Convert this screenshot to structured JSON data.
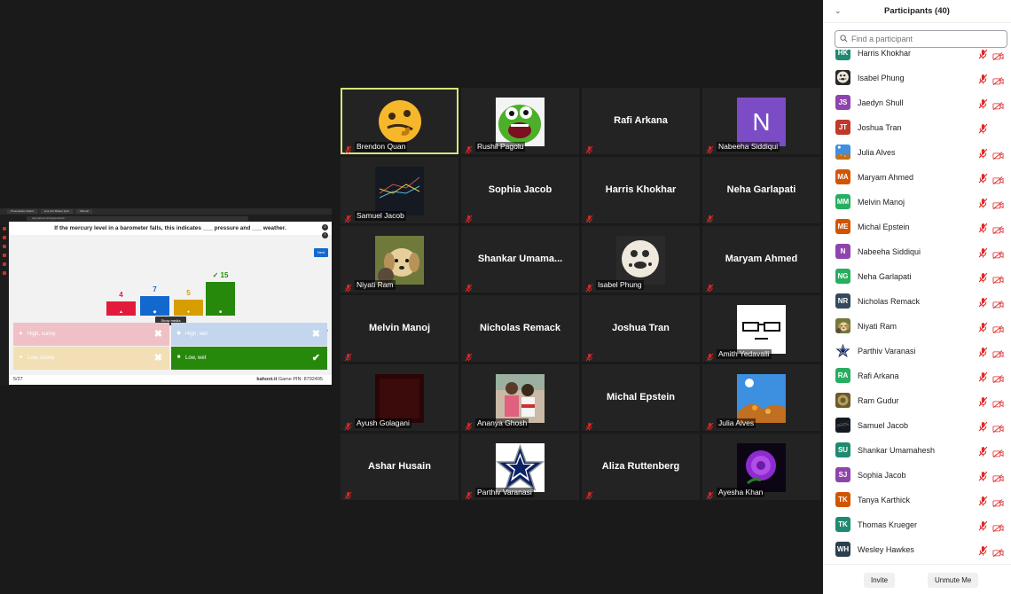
{
  "share": {
    "tabs": [
      "Presentation-Island",
      "Live Hot Master Quiz",
      "Kahoot!"
    ],
    "url": "play.kahoot.it/v2/gameblock",
    "question": "If the mercury level in a barometer falls, this indicates ___ pressure and ___ weather.",
    "next_label": "Next",
    "show_media_label": "Show media",
    "end_game_label": "End game",
    "results": [
      {
        "count": "4",
        "value": 4,
        "color": "#e21b3c",
        "shape": "▲"
      },
      {
        "count": "7",
        "value": 7,
        "color": "#1368ce",
        "shape": "◆"
      },
      {
        "count": "5",
        "value": 5,
        "color": "#d89e00",
        "shape": "●"
      },
      {
        "count": "✓ 15",
        "value": 15,
        "color": "#26890c",
        "shape": "■"
      }
    ],
    "answers": [
      {
        "text": "High, sunny",
        "shape": "▲",
        "mark": "✖",
        "color": "#f0c0c7"
      },
      {
        "text": "High, wet",
        "shape": "◆",
        "mark": "✖",
        "color": "#c3d6ee"
      },
      {
        "text": "Low, sunny",
        "shape": "●",
        "mark": "✖",
        "color": "#f2dfb5"
      },
      {
        "text": "Low, wet",
        "shape": "■",
        "mark": "✔",
        "color": "#26890c"
      }
    ],
    "progress": "5/27",
    "footer_site": "kahoot.it",
    "footer_pin": "Game PIN: 8792495"
  },
  "gallery": [
    {
      "name": "Brendon Quan",
      "type": "emoji",
      "active": true
    },
    {
      "name": "Rushil Pagolu",
      "type": "monster"
    },
    {
      "name": "Rafi Arkana",
      "type": "text",
      "label": ""
    },
    {
      "name": "Nabeeha Siddiqui",
      "type": "letter",
      "letter": "N"
    },
    {
      "name": "Samuel Jacob",
      "type": "dark"
    },
    {
      "name": "Sophia Jacob",
      "type": "text",
      "label": ""
    },
    {
      "name": "Harris Khokhar",
      "type": "text",
      "label": ""
    },
    {
      "name": "Neha Garlapati",
      "type": "text",
      "label": ""
    },
    {
      "name": "Niyati Ram",
      "type": "dog"
    },
    {
      "name": "Shankar  Umama...",
      "type": "text",
      "label": ""
    },
    {
      "name": "Isabel Phung",
      "type": "cookie"
    },
    {
      "name": "Maryam Ahmed",
      "type": "text",
      "label": ""
    },
    {
      "name": "Melvin Manoj",
      "type": "text",
      "label": ""
    },
    {
      "name": "Nicholas Remack",
      "type": "text",
      "label": ""
    },
    {
      "name": "Joshua Tran",
      "type": "text",
      "label": ""
    },
    {
      "name": "Amith Yedavalli",
      "type": "glasses"
    },
    {
      "name": "Ayush Golagani",
      "type": "darkred"
    },
    {
      "name": "Ananya Ghosh",
      "type": "photo"
    },
    {
      "name": "Michal Epstein",
      "type": "text",
      "label": ""
    },
    {
      "name": "Julia Alves",
      "type": "sky"
    },
    {
      "name": "Ashar Husain",
      "type": "text",
      "label": ""
    },
    {
      "name": "Parthiv Varanasi",
      "type": "star"
    },
    {
      "name": "Aliza Ruttenberg",
      "type": "text",
      "label": ""
    },
    {
      "name": "Ayesha Khan",
      "type": "rose"
    }
  ],
  "panel": {
    "title": "Participants (40)",
    "search_placeholder": "Find a participant",
    "invite_label": "Invite",
    "unmute_label": "Unmute Me",
    "participants": [
      {
        "initials": "HK",
        "name": "Harris Khokhar",
        "color": "#1f8a70",
        "video": true
      },
      {
        "initials": "",
        "name": "Isabel Phung",
        "color": "#555",
        "img": "cookie",
        "video": true
      },
      {
        "initials": "JS",
        "name": "Jaedyn Shull",
        "color": "#8e44ad",
        "video": true
      },
      {
        "initials": "JT",
        "name": "Joshua Tran",
        "color": "#c0392b",
        "video": false
      },
      {
        "initials": "",
        "name": "Julia Alves",
        "color": "#3b7fc4",
        "img": "sky",
        "video": true
      },
      {
        "initials": "MA",
        "name": "Maryam Ahmed",
        "color": "#d35400",
        "video": true
      },
      {
        "initials": "MM",
        "name": "Melvin Manoj",
        "color": "#27ae60",
        "video": true
      },
      {
        "initials": "ME",
        "name": "Michal Epstein",
        "color": "#d35400",
        "video": true
      },
      {
        "initials": "N",
        "name": "Nabeeha Siddiqui",
        "color": "#8e44ad",
        "video": true
      },
      {
        "initials": "NG",
        "name": "Neha Garlapati",
        "color": "#27ae60",
        "video": true
      },
      {
        "initials": "NR",
        "name": "Nicholas Remack",
        "color": "#34495e",
        "video": true
      },
      {
        "initials": "",
        "name": "Niyati Ram",
        "color": "#a08060",
        "img": "dog",
        "video": true
      },
      {
        "initials": "",
        "name": "Parthiv Varanasi",
        "color": "#fff",
        "img": "star",
        "video": true
      },
      {
        "initials": "RA",
        "name": "Rafi Arkana",
        "color": "#27ae60",
        "video": true
      },
      {
        "initials": "",
        "name": "Ram Gudur",
        "color": "#7a6a3a",
        "img": "round",
        "video": true
      },
      {
        "initials": "",
        "name": "Samuel Jacob",
        "color": "#222",
        "img": "dark",
        "video": true
      },
      {
        "initials": "SU",
        "name": "Shankar Umamahesh",
        "color": "#1f8a70",
        "video": true
      },
      {
        "initials": "SJ",
        "name": "Sophia Jacob",
        "color": "#8e44ad",
        "video": true
      },
      {
        "initials": "TK",
        "name": "Tanya Karthick",
        "color": "#d35400",
        "video": true
      },
      {
        "initials": "TK",
        "name": "Thomas Krueger",
        "color": "#1f8a70",
        "video": true
      },
      {
        "initials": "WH",
        "name": "Wesley Hawkes",
        "color": "#2c3e50",
        "video": true
      }
    ]
  }
}
